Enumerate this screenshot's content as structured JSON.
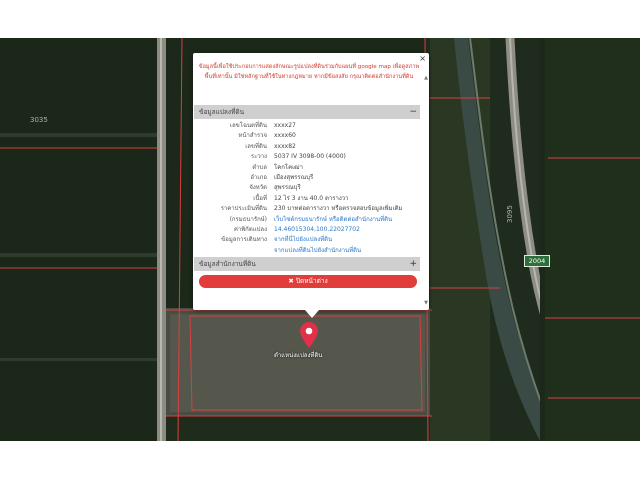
{
  "notice": "ข้อมูลนี้เพื่อใช้ประกอบการแสดงลักษณะรูปแปลงที่ดินร่วมกับแผนที่ google map เพื่อดูสภาพพื้นที่เท่านั้น มิใช่หลักฐานที่ใช้ในทางกฎหมาย หากมีข้อสงสัย กรุณาติดต่อสำนักงานที่ดิน",
  "close_icon": "×",
  "scroll_up_icon": "▲",
  "scroll_down_icon": "▼",
  "section_parcel": {
    "title": "ข้อมูลแปลงที่ดิน",
    "toggle": "−"
  },
  "section_office": {
    "title": "ข้อมูลสำนักงานที่ดิน",
    "toggle": "+"
  },
  "rows": [
    {
      "label": "เลขโฉนดที่ดิน",
      "value": "xxxx27"
    },
    {
      "label": "หน้าสำรวจ",
      "value": "xxxx60"
    },
    {
      "label": "เลขที่ดิน",
      "value": "xxxx82"
    },
    {
      "label": "ระวาง",
      "value": "5037 IV 3098-00 (4000)"
    },
    {
      "label": "ตำบล",
      "value": "โคกโคเฒ่า"
    },
    {
      "label": "อำเภอ",
      "value": "เมืองสุพรรณบุรี"
    },
    {
      "label": "จังหวัด",
      "value": "สุพรรณบุรี"
    },
    {
      "label": "เนื้อที่",
      "value": "12 ไร่ 3 งาน 40.0 ตารางวา"
    },
    {
      "label": "ราคาประเมินที่ดิน",
      "value": "230 บาทต่อตารางวา หรือตรวจสอบข้อมูลเพิ่มเติม"
    },
    {
      "label": "(กรมธนารักษ์)",
      "value": "เว็บไซต์กรมธนารักษ์ หรือติดต่อสำนักงานที่ดิน",
      "link": true
    },
    {
      "label": "ค่าพิกัดแปลง",
      "value": "14.46015304,100.22027702",
      "link": true
    },
    {
      "label": "ข้อมูลการเดินทาง",
      "value": "จากที่นี่ไปยังแปลงที่ดิน",
      "link": true
    },
    {
      "label": "",
      "value": "จากแปลงที่ดินไปยังสำนักงานที่ดิน",
      "link": true
    }
  ],
  "close_button": {
    "icon": "✖",
    "label": "ปิดหน้าต่าง"
  },
  "marker_label": "ตำแหน่งแปลงที่ดิน",
  "road_number": "2004",
  "map_labels": {
    "left": "3035",
    "right": "3095"
  },
  "colors": {
    "accent_red": "#e13d3a",
    "link_blue": "#2a78c8",
    "parcel_outline": "#d84040"
  }
}
